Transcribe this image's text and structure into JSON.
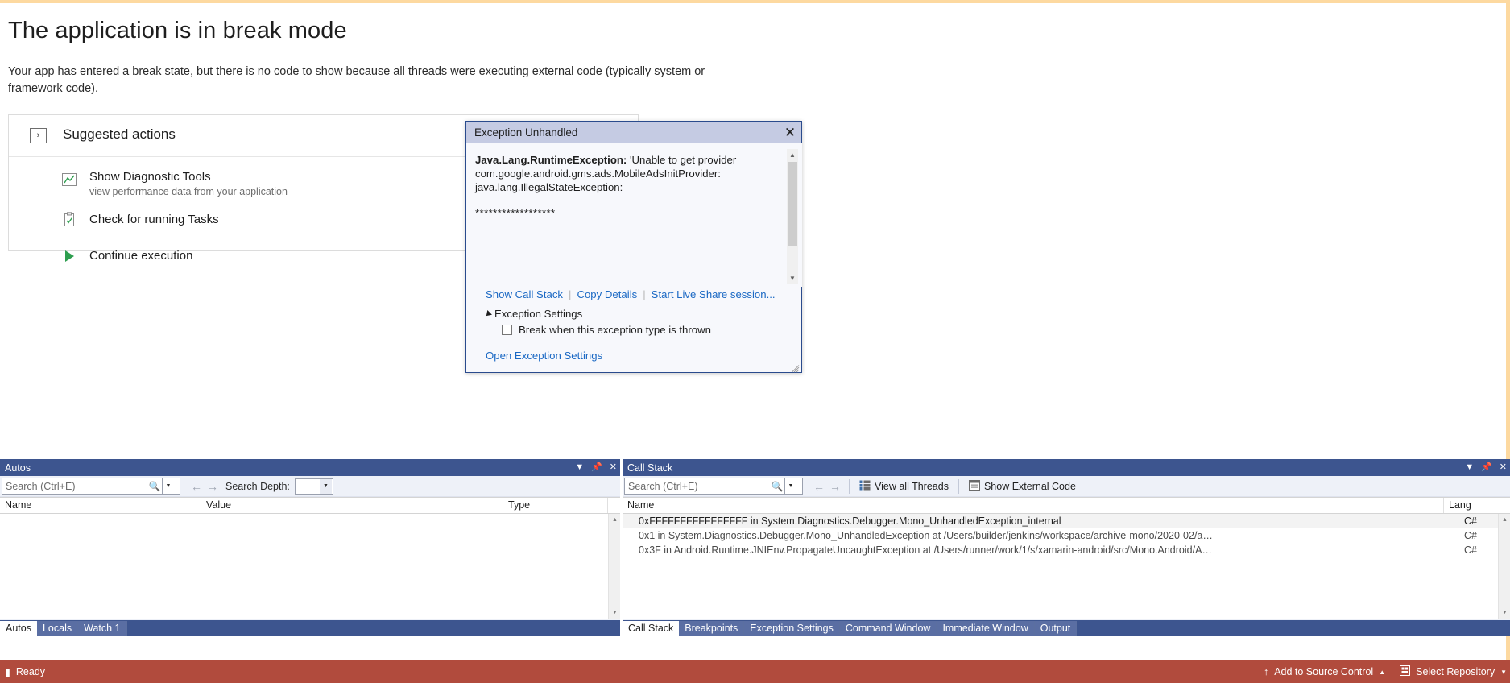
{
  "break_page": {
    "title": "The application is in break mode",
    "subtitle": "Your app has entered a break state, but there is no code to show because all threads were executing external code (typically system or framework code).",
    "suggested_actions": {
      "header_label": "Suggested actions",
      "header_icon": "step-into-icon",
      "collapse_icon": "chevron-up-icon",
      "items": [
        {
          "icon": "diagnostic-tools-icon",
          "title": "Show Diagnostic Tools",
          "description": "view performance data from your application"
        },
        {
          "icon": "tasks-clipboard-icon",
          "title": "Check for running Tasks",
          "description": ""
        },
        {
          "icon": "continue-play-icon",
          "title": "Continue execution",
          "description": ""
        }
      ]
    }
  },
  "exception_dialog": {
    "title": "Exception Unhandled",
    "close_icon": "close-icon",
    "exception_type": "Java.Lang.RuntimeException:",
    "exception_message": " 'Unable to get provider com.google.android.gms.ads.MobileAdsInitProvider: java.lang.IllegalStateException:",
    "stars": "******************",
    "links": [
      "Show Call Stack",
      "Copy Details",
      "Start Live Share session..."
    ],
    "settings_section_label": "Exception Settings",
    "checkbox_label": "Break when this exception type is thrown",
    "checkbox_checked": false,
    "open_settings_link": "Open Exception Settings"
  },
  "autos_panel": {
    "title": "Autos",
    "window_buttons": [
      "dropdown-icon",
      "pin-icon",
      "close-icon"
    ],
    "search_placeholder": "Search (Ctrl+E)",
    "search_value": "",
    "search_depth_label": "Search Depth:",
    "search_depth_value": "",
    "columns": [
      "Name",
      "Value",
      "Type"
    ],
    "rows": [],
    "tabs": [
      {
        "label": "Autos",
        "active": true
      },
      {
        "label": "Locals",
        "active": false
      },
      {
        "label": "Watch 1",
        "active": false
      }
    ]
  },
  "call_stack_panel": {
    "title": "Call Stack",
    "window_buttons": [
      "dropdown-icon",
      "pin-icon",
      "close-icon"
    ],
    "search_placeholder": "Search (Ctrl+E)",
    "search_value": "",
    "view_all_threads_label": "View all Threads",
    "show_external_code_label": "Show External Code",
    "columns": [
      "Name",
      "Lang"
    ],
    "rows": [
      {
        "name": "0xFFFFFFFFFFFFFFFF in System.Diagnostics.Debugger.Mono_UnhandledException_internal",
        "lang": "C#",
        "selected": true
      },
      {
        "name": "0x1 in System.Diagnostics.Debugger.Mono_UnhandledException at /Users/builder/jenkins/workspace/archive-mono/2020-02/a…",
        "lang": "C#",
        "selected": false
      },
      {
        "name": "0x3F in Android.Runtime.JNIEnv.PropagateUncaughtException at /Users/runner/work/1/s/xamarin-android/src/Mono.Android/A…",
        "lang": "C#",
        "selected": false
      }
    ],
    "tabs": [
      {
        "label": "Call Stack",
        "active": true
      },
      {
        "label": "Breakpoints",
        "active": false
      },
      {
        "label": "Exception Settings",
        "active": false
      },
      {
        "label": "Command Window",
        "active": false
      },
      {
        "label": "Immediate Window",
        "active": false
      },
      {
        "label": "Output",
        "active": false
      }
    ]
  },
  "status_bar": {
    "status_text": "Ready",
    "add_to_source_control": "Add to Source Control",
    "select_repository": "Select Repository",
    "upload_icon": "arrow-up-icon",
    "repo_icon": "repository-icon",
    "caret_icon": "caret-up-icon"
  },
  "colors": {
    "accent_orange": "#fdd9a0",
    "panel_header": "#3d558f",
    "status_bar": "#b14b3d",
    "dialog_title": "#c5cbe3",
    "link_blue": "#1b69c4"
  }
}
